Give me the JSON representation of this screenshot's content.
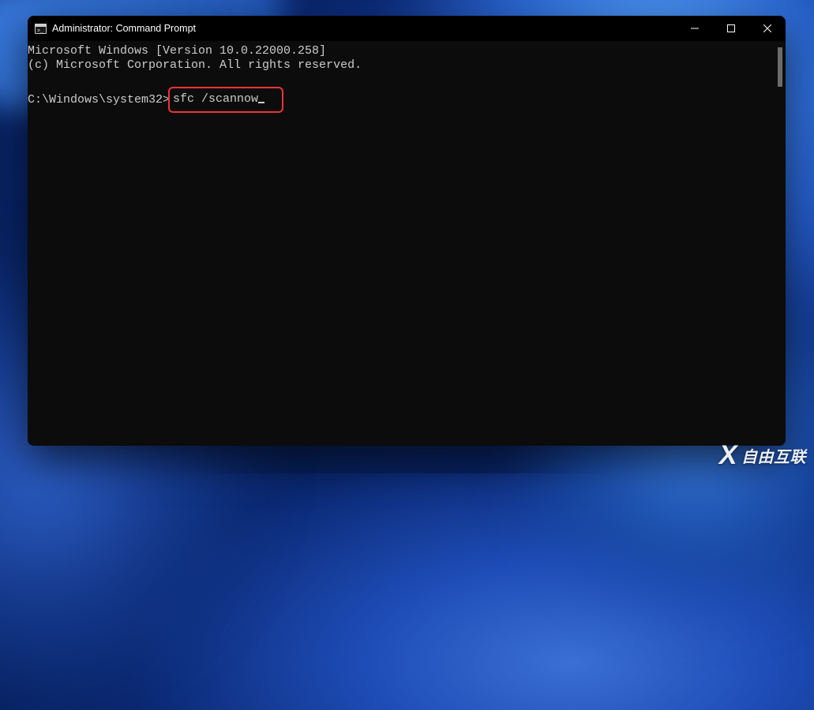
{
  "window": {
    "title": "Administrator: Command Prompt"
  },
  "terminal": {
    "line1": "Microsoft Windows [Version 10.0.22000.258]",
    "line2": "(c) Microsoft Corporation. All rights reserved.",
    "prompt": "C:\\Windows\\system32>",
    "command": "sfc /scannow"
  },
  "watermark": {
    "text": "自由互联"
  }
}
